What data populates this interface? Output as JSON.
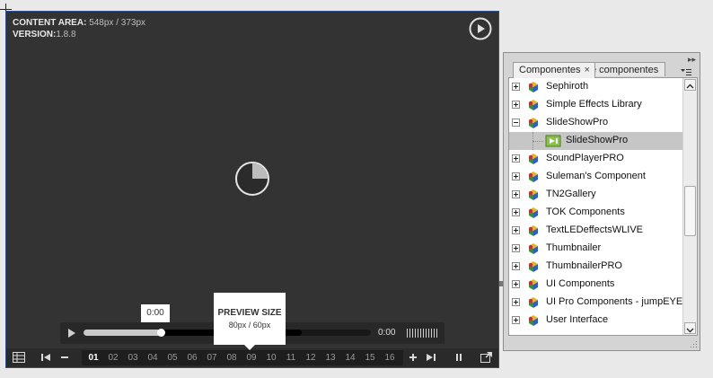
{
  "stage": {
    "content_area_label": "CONTENT AREA:",
    "content_area_value": "548px / 373px",
    "version_label": "VERSION:",
    "version_value": "1.8.8"
  },
  "player": {
    "time_tooltip": "0:00",
    "preview_title": "PREVIEW SIZE",
    "preview_size": "80px / 60px",
    "time_display": "0:00",
    "progress": {
      "played_fraction": 0.27,
      "buffered_fraction": 0.76
    },
    "pages": [
      "01",
      "02",
      "03",
      "04",
      "05",
      "06",
      "07",
      "08",
      "09",
      "10",
      "11",
      "12",
      "13",
      "14",
      "15",
      "16"
    ],
    "active_page": "01",
    "icons": [
      "gallery-grid-icon",
      "previous-gallery-icon",
      "minus-icon",
      "plus-icon",
      "next-gallery-icon",
      "pause-icon",
      "fullscreen-icon",
      "play-icon",
      "loading-icon"
    ]
  },
  "panel": {
    "active_tab": "Componentes",
    "tab_close": "×",
    "other_tab": "e componentes",
    "items": [
      {
        "label": "Sephiroth",
        "expander": "plus"
      },
      {
        "label": "Simple Effects Library",
        "expander": "plus"
      },
      {
        "label": "SlideShowPro",
        "expander": "minus"
      },
      {
        "label": "SlideShowPro",
        "child": true,
        "selected": true
      },
      {
        "label": "SoundPlayerPRO",
        "expander": "plus"
      },
      {
        "label": "Suleman's Component",
        "expander": "plus"
      },
      {
        "label": "TN2Gallery",
        "expander": "plus"
      },
      {
        "label": "TOK Components",
        "expander": "plus"
      },
      {
        "label": "TextLEDeffectsWLIVE",
        "expander": "plus"
      },
      {
        "label": "Thumbnailer",
        "expander": "plus"
      },
      {
        "label": "ThumbnailerPRO",
        "expander": "plus"
      },
      {
        "label": "UI Components",
        "expander": "plus"
      },
      {
        "label": "UI Pro Components - jumpEYE",
        "expander": "plus"
      },
      {
        "label": "User Interface",
        "expander": "plus"
      }
    ]
  },
  "colors": {
    "player_bg": "#333333",
    "player_border": "#2d4f8a",
    "panel_bg": "#d4d4d4",
    "selected_row": "#c6c6c6"
  }
}
